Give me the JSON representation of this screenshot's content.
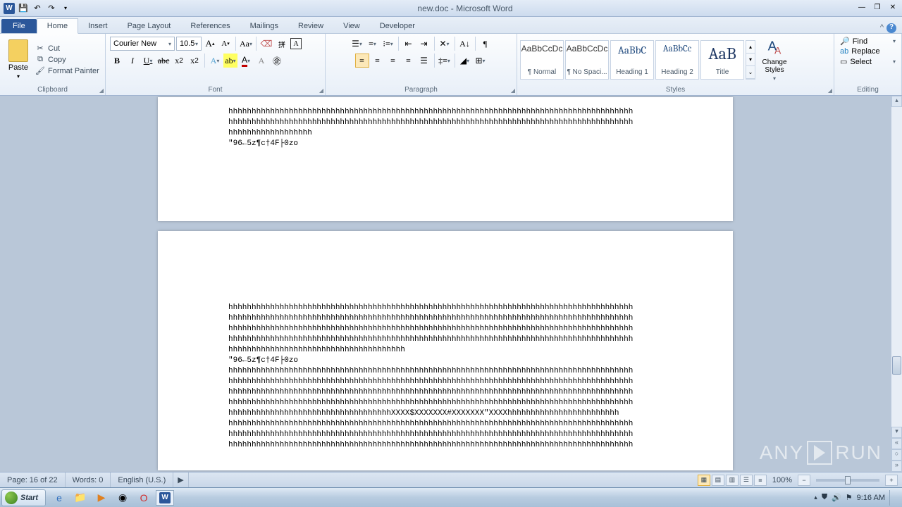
{
  "title": "new.doc - Microsoft Word",
  "qat": {
    "word": "W"
  },
  "tabs": [
    "File",
    "Home",
    "Insert",
    "Page Layout",
    "References",
    "Mailings",
    "Review",
    "View",
    "Developer"
  ],
  "clipboard": {
    "paste": "Paste",
    "cut": "Cut",
    "copy": "Copy",
    "format_painter": "Format Painter",
    "label": "Clipboard"
  },
  "font": {
    "name": "Courier New",
    "size": "10.5",
    "label": "Font"
  },
  "paragraph": {
    "label": "Paragraph"
  },
  "styles": {
    "items": [
      {
        "preview": "AaBbCcDc",
        "label": "¶ Normal"
      },
      {
        "preview": "AaBbCcDc",
        "label": "¶ No Spaci..."
      },
      {
        "preview": "AaBbC",
        "label": "Heading 1"
      },
      {
        "preview": "AaBbCc",
        "label": "Heading 2"
      },
      {
        "preview": "AaB",
        "label": "Title"
      }
    ],
    "change": "Change Styles",
    "label": "Styles"
  },
  "editing": {
    "find": "Find",
    "replace": "Replace",
    "select": "Select",
    "label": "Editing"
  },
  "doc": {
    "p1_l1": "hhhhhhhhhhhhhhhhhhhhhhhhhhhhhhhhhhhhhhhhhhhhhhhhhhhhhhhhhhhhhhhhhhhhhhhhhhhhhhhhhhhhhhh",
    "p1_l2": "hhhhhhhhhhhhhhhhhhhhhhhhhhhhhhhhhhhhhhhhhhhhhhhhhhhhhhhhhhhhhhhhhhhhhhhhhhhhhhhhhhhhhhh",
    "p1_l3": "hhhhhhhhhhhhhhhhhh",
    "p1_l4": "\"96←5z¶c†4F├0zo",
    "p2_l1": "hhhhhhhhhhhhhhhhhhhhhhhhhhhhhhhhhhhhhhhhhhhhhhhhhhhhhhhhhhhhhhhhhhhhhhhhhhhhhhhhhhhhhhh",
    "p2_l2": "hhhhhhhhhhhhhhhhhhhhhhhhhhhhhhhhhhhhhhhhhhhhhhhhhhhhhhhhhhhhhhhhhhhhhhhhhhhhhhhhhhhhhhh",
    "p2_l3": "hhhhhhhhhhhhhhhhhhhhhhhhhhhhhhhhhhhhhhhhhhhhhhhhhhhhhhhhhhhhhhhhhhhhhhhhhhhhhhhhhhhhhhh",
    "p2_l4": "hhhhhhhhhhhhhhhhhhhhhhhhhhhhhhhhhhhhhhhhhhhhhhhhhhhhhhhhhhhhhhhhhhhhhhhhhhhhhhhhhhhhhhh",
    "p2_l5": "hhhhhhhhhhhhhhhhhhhhhhhhhhhhhhhhhhhhhh",
    "p2_l6": "\"96←5z¶c†4F├0zo",
    "p2_l7": "hhhhhhhhhhhhhhhhhhhhhhhhhhhhhhhhhhhhhhhhhhhhhhhhhhhhhhhhhhhhhhhhhhhhhhhhhhhhhhhhhhhhhhh",
    "p2_l8": "hhhhhhhhhhhhhhhhhhhhhhhhhhhhhhhhhhhhhhhhhhhhhhhhhhhhhhhhhhhhhhhhhhhhhhhhhhhhhhhhhhhhhhh",
    "p2_l9": "hhhhhhhhhhhhhhhhhhhhhhhhhhhhhhhhhhhhhhhhhhhhhhhhhhhhhhhhhhhhhhhhhhhhhhhhhhhhhhhhhhhhhhh",
    "p2_l10": "hhhhhhhhhhhhhhhhhhhhhhhhhhhhhhhhhhhhhhhhhhhhhhhhhhhhhhhhhhhhhhhhhhhhhhhhhhhhhhhhhhhhhhh",
    "p2_l11": "hhhhhhhhhhhhhhhhhhhhhhhhhhhhhhhhhhhXXXX$XXXXXXX#XXXXXXX\"XXXXhhhhhhhhhhhhhhhhhhhhhhhh",
    "p2_l12": "hhhhhhhhhhhhhhhhhhhhhhhhhhhhhhhhhhhhhhhhhhhhhhhhhhhhhhhhhhhhhhhhhhhhhhhhhhhhhhhhhhhhhhh",
    "p2_l13": "hhhhhhhhhhhhhhhhhhhhhhhhhhhhhhhhhhhhhhhhhhhhhhhhhhhhhhhhhhhhhhhhhhhhhhhhhhhhhhhhhhhhhhh",
    "p2_l14": "hhhhhhhhhhhhhhhhhhhhhhhhhhhhhhhhhhhhhhhhhhhhhhhhhhhhhhhhhhhhhhhhhhhhhhhhhhhhhhhhhhhhhhh"
  },
  "status": {
    "page": "Page: 16 of 22",
    "words": "Words: 0",
    "lang": "English (U.S.)",
    "zoom": "100%"
  },
  "taskbar": {
    "start": "Start",
    "time": "9:16 AM"
  },
  "watermark": {
    "t1": "ANY",
    "t2": "RUN"
  }
}
